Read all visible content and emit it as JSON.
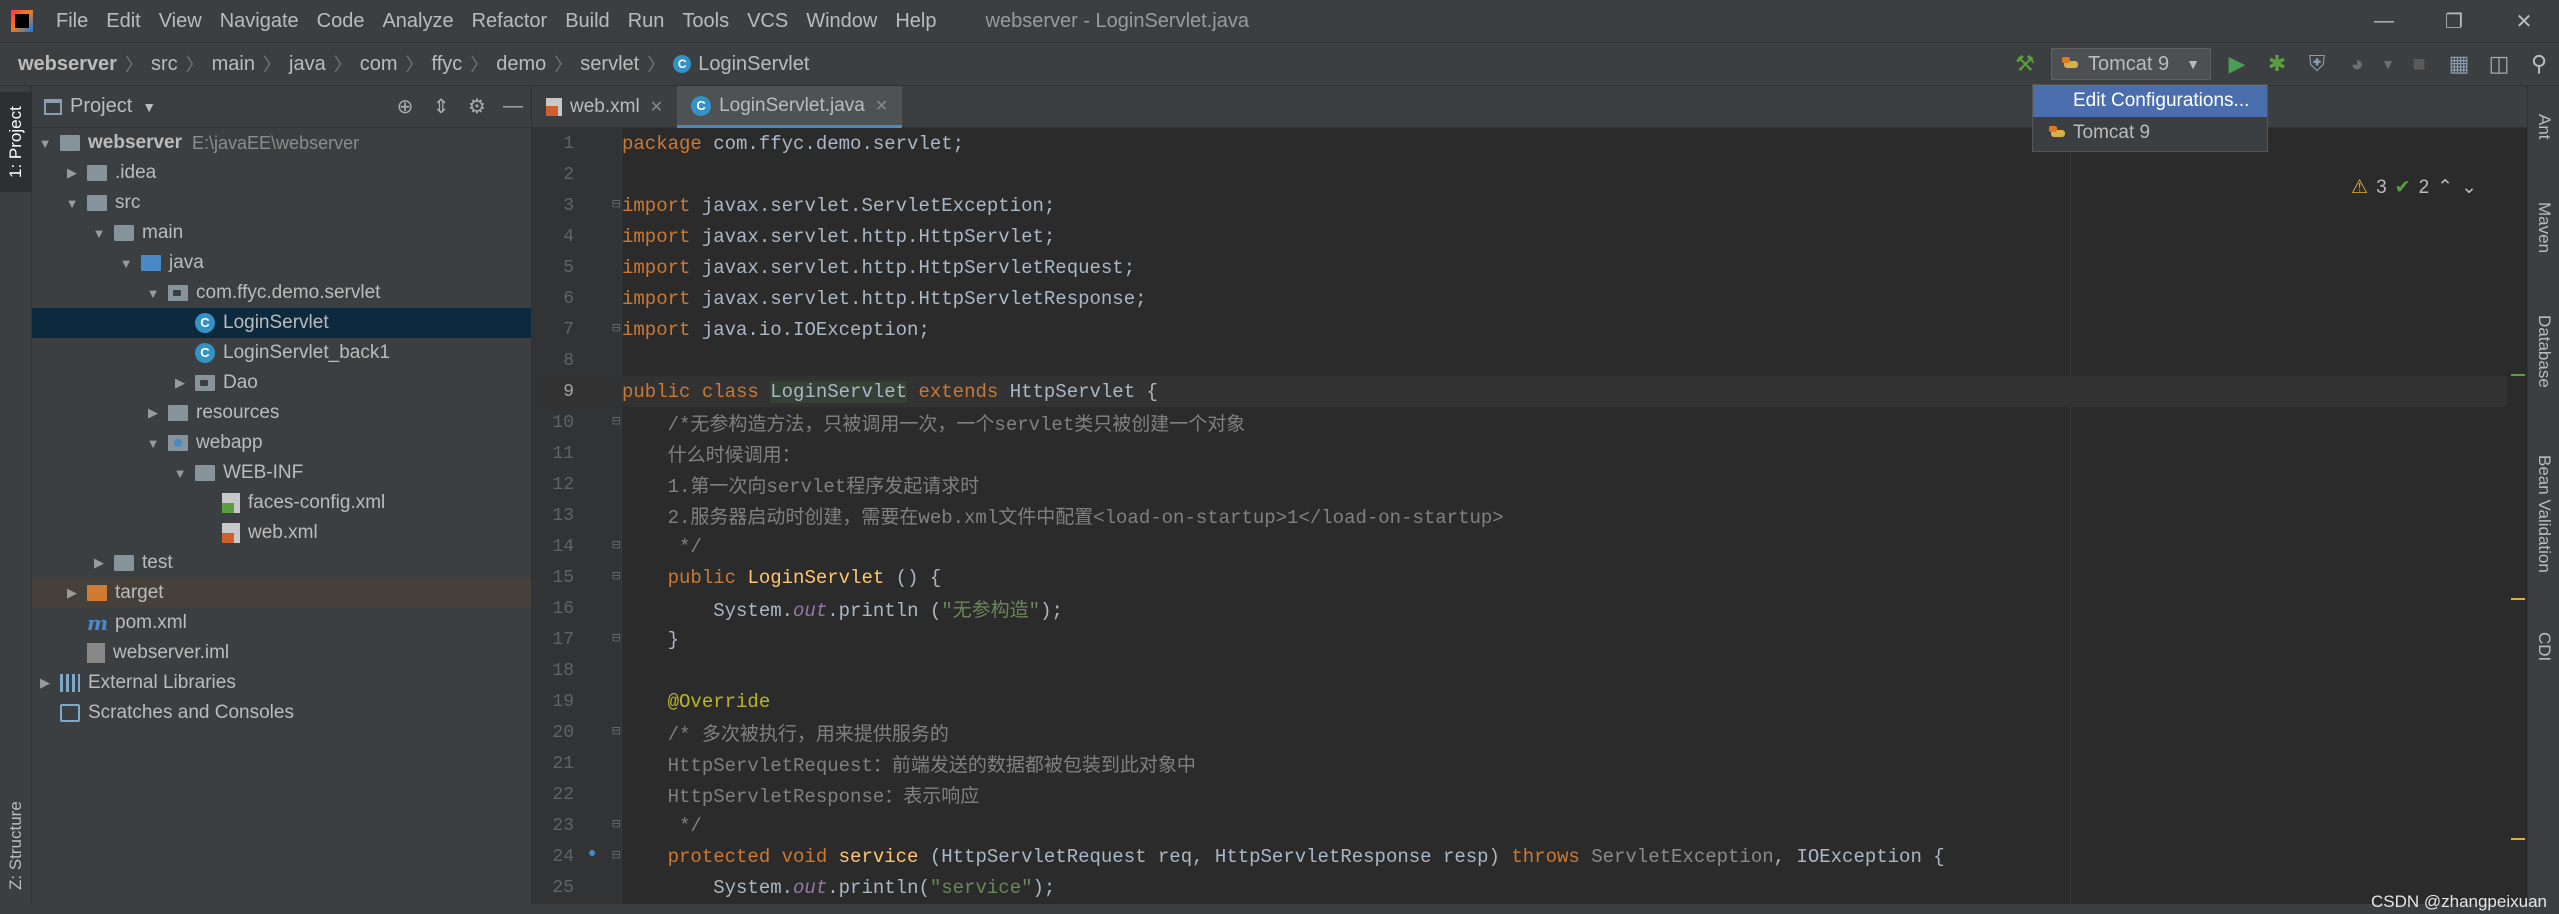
{
  "menubar": {
    "items": [
      "File",
      "Edit",
      "View",
      "Navigate",
      "Code",
      "Analyze",
      "Refactor",
      "Build",
      "Run",
      "Tools",
      "VCS",
      "Window",
      "Help"
    ],
    "window_title": "webserver - LoginServlet.java"
  },
  "breadcrumb": [
    "webserver",
    "src",
    "main",
    "java",
    "com",
    "ffyc",
    "demo",
    "servlet",
    "LoginServlet"
  ],
  "toolbar": {
    "run_config": "Tomcat 9"
  },
  "run_dropdown": {
    "items": [
      "Edit Configurations...",
      "Tomcat 9"
    ],
    "selected_index": 0
  },
  "left_stripe": {
    "project_tab": "1: Project",
    "structure_tab": "Z: Structure"
  },
  "project_panel": {
    "title": "Project",
    "tree": [
      {
        "label": "webserver",
        "path": "E:\\javaEE\\webserver"
      },
      {
        "label": ".idea"
      },
      {
        "label": "src"
      },
      {
        "label": "main"
      },
      {
        "label": "java"
      },
      {
        "label": "com.ffyc.demo.servlet"
      },
      {
        "label": "LoginServlet"
      },
      {
        "label": "LoginServlet_back1"
      },
      {
        "label": "Dao"
      },
      {
        "label": "resources"
      },
      {
        "label": "webapp"
      },
      {
        "label": "WEB-INF"
      },
      {
        "label": "faces-config.xml"
      },
      {
        "label": "web.xml"
      },
      {
        "label": "test"
      },
      {
        "label": "target"
      },
      {
        "label": "pom.xml"
      },
      {
        "label": "webserver.iml"
      },
      {
        "label": "External Libraries"
      },
      {
        "label": "Scratches and Consoles"
      }
    ]
  },
  "editor": {
    "tabs": [
      "web.xml",
      "LoginServlet.java"
    ],
    "active_tab": 1,
    "inspections": {
      "warnings": "3",
      "ok": "2"
    },
    "lines": [
      {
        "n": "1",
        "text": "package com.ffyc.demo.servlet;"
      },
      {
        "n": "2",
        "text": ""
      },
      {
        "n": "3",
        "text": "import javax.servlet.ServletException;"
      },
      {
        "n": "4",
        "text": "import javax.servlet.http.HttpServlet;"
      },
      {
        "n": "5",
        "text": "import javax.servlet.http.HttpServletRequest;"
      },
      {
        "n": "6",
        "text": "import javax.servlet.http.HttpServletResponse;"
      },
      {
        "n": "7",
        "text": "import java.io.IOException;"
      },
      {
        "n": "8",
        "text": ""
      },
      {
        "n": "9",
        "text": "public class LoginServlet extends HttpServlet {"
      },
      {
        "n": "10",
        "text": "    /*无参构造方法，只被调用一次，一个servlet类只被创建一个对象"
      },
      {
        "n": "11",
        "text": "    什么时候调用："
      },
      {
        "n": "12",
        "text": "    1.第一次向servlet程序发起请求时"
      },
      {
        "n": "13",
        "text": "    2.服务器启动时创建，需要在web.xml文件中配置<load-on-startup>1</load-on-startup>"
      },
      {
        "n": "14",
        "text": "     */"
      },
      {
        "n": "15",
        "text": "    public LoginServlet () {"
      },
      {
        "n": "16",
        "text": "        System.out.println (\"无参构造\");"
      },
      {
        "n": "17",
        "text": "    }"
      },
      {
        "n": "18",
        "text": ""
      },
      {
        "n": "19",
        "text": "    @Override"
      },
      {
        "n": "20",
        "text": "    /* 多次被执行，用来提供服务的"
      },
      {
        "n": "21",
        "text": "    HttpServletRequest：前端发送的数据都被包装到此对象中"
      },
      {
        "n": "22",
        "text": "    HttpServletResponse：表示响应"
      },
      {
        "n": "23",
        "text": "     */"
      },
      {
        "n": "24",
        "text": "    protected void service (HttpServletRequest req, HttpServletResponse resp) throws ServletException, IOException {"
      },
      {
        "n": "25",
        "text": "        System.out.println(\"service\");"
      }
    ]
  },
  "right_stripe": [
    "Ant",
    "Maven",
    "Database",
    "Bean Validation",
    "CDI"
  ],
  "watermark": "CSDN @zhangpeixuan",
  "colors": {
    "keyword": "#cc7832",
    "comment": "#808080",
    "string": "#6a8759",
    "annotation": "#bbb529",
    "function": "#ffc66d",
    "static_field": "#9876aa",
    "selection": "#4b6eaf"
  }
}
